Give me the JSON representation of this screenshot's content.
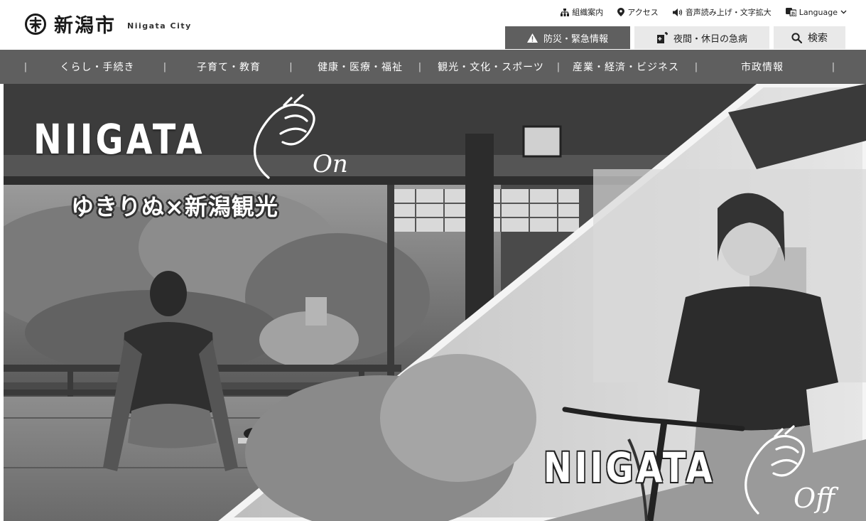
{
  "site": {
    "name_ja": "新潟市",
    "name_en": "Niigata City"
  },
  "utility": [
    {
      "label": "組織案内",
      "icon": "org-chart-icon"
    },
    {
      "label": "アクセス",
      "icon": "location-pin-icon"
    },
    {
      "label": "音声読み上げ・文字拡大",
      "icon": "speaker-icon"
    },
    {
      "label": "Language",
      "icon": "translate-icon"
    }
  ],
  "header_buttons": {
    "emergency": "防災・緊急情報",
    "night": "夜間・休日の急病",
    "search": "検索"
  },
  "nav": [
    "くらし・手続き",
    "子育て・教育",
    "健康・医療・福祉",
    "観光・文化・スポーツ",
    "産業・経済・ビジネス",
    "市政情報"
  ],
  "hero": {
    "title_left": "NIIGATA",
    "script_left": "On",
    "subtitle_left": "ゆきりぬ×新潟観光",
    "title_right": "NIIGATA",
    "script_right": "Off"
  },
  "colors": {
    "nav_bg": "#5f5f5f",
    "button_light": "#e9e9e9"
  }
}
